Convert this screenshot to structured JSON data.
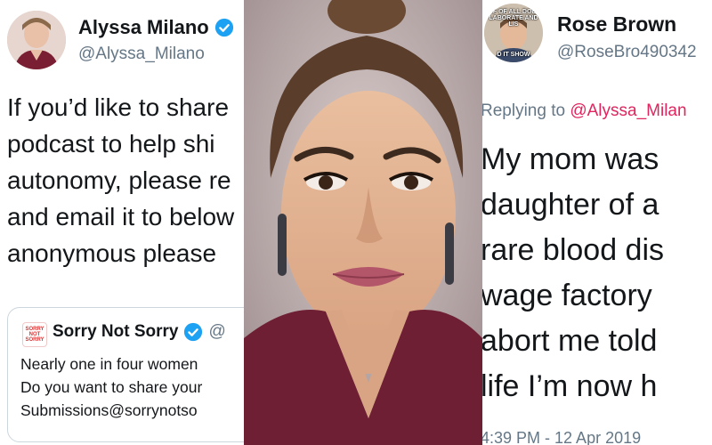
{
  "left_tweet": {
    "author_name": "Alyssa Milano",
    "author_handle": "@Alyssa_Milano",
    "body_lines": [
      "If you’d like to share",
      "podcast to help shi",
      "autonomy, please re",
      "and email it to below",
      "anonymous please"
    ],
    "quoted_tweet": {
      "author_name": "Sorry Not Sorry",
      "author_handle": "@",
      "logo_text": "SORRY NOT SORRY",
      "body_lines": [
        "Nearly one in four women",
        "Do you want to share your",
        "Submissions@sorrynotso"
      ]
    }
  },
  "right_tweet": {
    "author_name": "Rose Brown",
    "author_handle": "@RoseBro490342",
    "avatar_caption_top": "IF OF ALL DOE LABORATE AND LIS",
    "avatar_caption_bottom": "D IT SHOW",
    "reply_prefix": "Replying to",
    "reply_to": "@Alyssa_Milan",
    "body_lines": [
      "My mom was",
      "daughter of a",
      "rare blood dis",
      "wage factory",
      "abort me told",
      "life I’m now h"
    ],
    "timestamp": "4:39 PM - 12 Apr 2019"
  },
  "colors": {
    "verified_blue": "#1da1f2",
    "mention_pink": "#e0245e",
    "secondary_gray": "#657786",
    "text_dark": "#14171a",
    "card_border": "#ccd6dd"
  }
}
